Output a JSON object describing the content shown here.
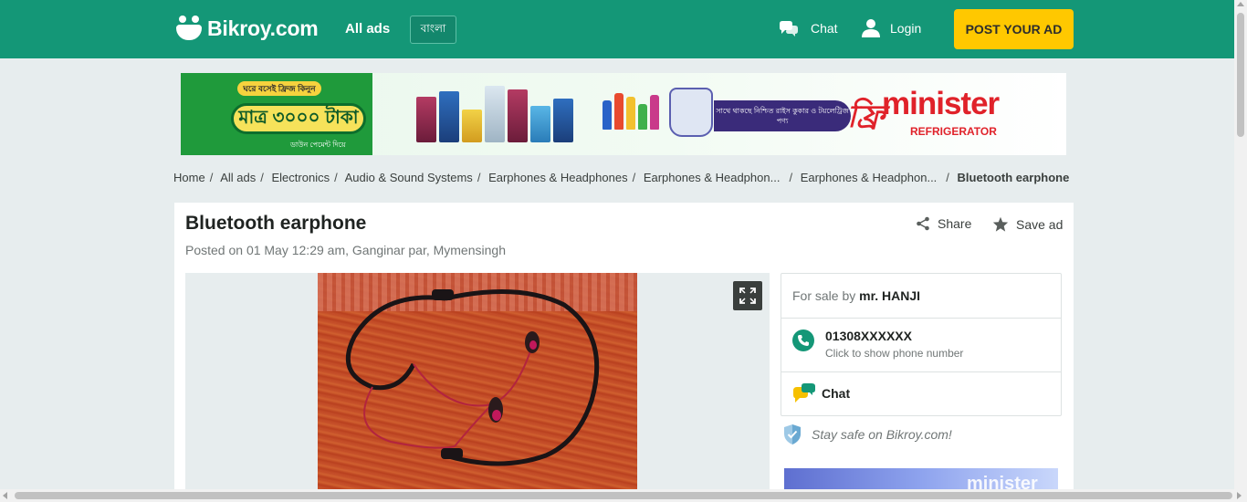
{
  "header": {
    "logo_text": "Bikroy.com",
    "all_ads": "All ads",
    "language": "বাংলা",
    "chat": "Chat",
    "login": "Login",
    "post_ad": "POST YOUR AD",
    "colors": {
      "header_bg": "#149777",
      "post_button": "#ffc800"
    }
  },
  "banner": {
    "promo_top": "ঘরে বসেই ফ্রিজ কিনুন",
    "price": "মাত্র ৩০০০ টাকা",
    "promo_sub": "ডাউন পেমেন্ট দিয়ে",
    "offer": "সাথে থাকছে নিশ্চিত রাইস কুকার ও টয়লেট্রিজ পণ্য",
    "free": "ফ্রি",
    "brand": "minister",
    "brand_sub": "REFRIGERATOR"
  },
  "breadcrumb": [
    "Home",
    "All ads",
    "Electronics",
    "Audio & Sound Systems",
    "Earphones & Headphones",
    "Earphones & Headphon...",
    "Earphones & Headphon...",
    "Bluetooth earphone"
  ],
  "ad": {
    "title": "Bluetooth earphone",
    "meta": "Posted on 01 May 12:29 am, Ganginar par, Mymensingh",
    "share": "Share",
    "save": "Save ad"
  },
  "seller": {
    "for_sale_by": "For sale by",
    "name": "mr. HANJI",
    "phone": "01308XXXXXX",
    "phone_hint": "Click to show phone number",
    "chat": "Chat",
    "stay_safe": "Stay safe on Bikroy.com!"
  },
  "side_ad": {
    "brand": "minister"
  }
}
